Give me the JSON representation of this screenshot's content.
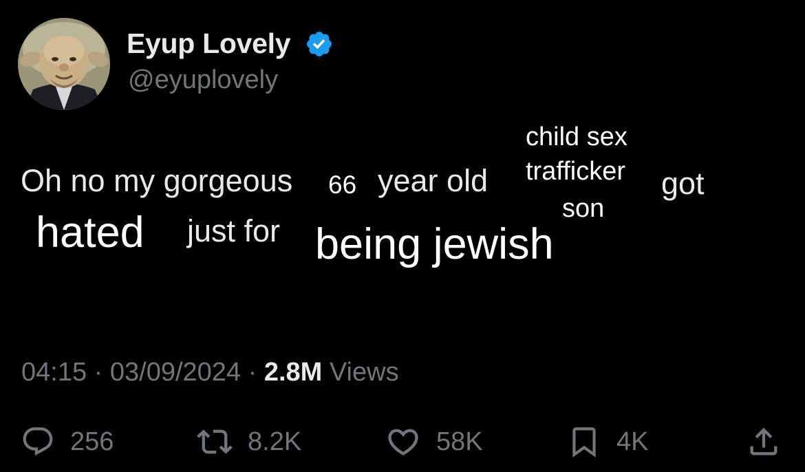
{
  "author": {
    "display_name": "Eyup Lovely",
    "handle": "@eyuplovely",
    "verified": true,
    "verified_color": "#1d9bf0"
  },
  "tweet_words": {
    "w1": "Oh no my gorgeous",
    "w2": "66",
    "w3": "year old",
    "w4": "child sex",
    "w5": "trafficker",
    "w6": "son",
    "w7": "got",
    "w8": "hated",
    "w9": "just for",
    "w10": "being jewish"
  },
  "meta": {
    "time": "04:15",
    "date": "03/09/2024",
    "separator": "·",
    "views_count": "2.8M",
    "views_label": "Views"
  },
  "actions": {
    "reply_count": "256",
    "retweet_count": "8.2K",
    "like_count": "58K",
    "bookmark_count": "4K"
  },
  "icons": {
    "reply": "reply-icon",
    "retweet": "retweet-icon",
    "like": "heart-icon",
    "bookmark": "bookmark-icon",
    "share": "share-icon",
    "verified": "verified-badge-icon"
  },
  "colors": {
    "background": "#000000",
    "primary_text": "#e7e9ea",
    "secondary_text": "#71767b",
    "accent": "#1d9bf0"
  }
}
